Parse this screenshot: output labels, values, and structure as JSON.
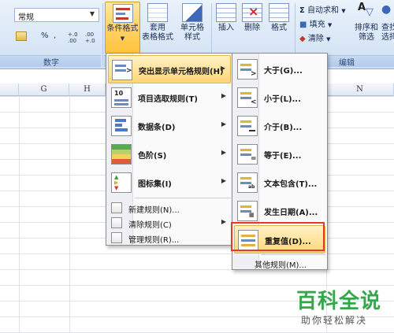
{
  "ribbon": {
    "number_group": {
      "format_value": "常规",
      "percent_label": "%",
      "comma_label": ",",
      "increase_decimal_label": "+.0 .00",
      "decrease_decimal_label": ".00 +.0",
      "label": "数字"
    },
    "styles_group": {
      "conditional_format_label": "条件格式",
      "table_format_label_1": "套用",
      "table_format_label_2": "表格格式",
      "cell_styles_label_1": "单元格",
      "cell_styles_label_2": "样式"
    },
    "cells_group": {
      "insert_label": "插入",
      "delete_label": "删除",
      "format_label": "格式"
    },
    "editing_group": {
      "autosum_label": "自动求和",
      "fill_label": "填充",
      "clear_label": "清除",
      "sort_filter_label_1": "排序和",
      "sort_filter_label_2": "筛选",
      "find_select_label_1": "查找",
      "find_select_label_2": "选择",
      "label": "编辑"
    }
  },
  "sheet": {
    "columns": [
      "G",
      "H",
      "N"
    ]
  },
  "cond_menu": {
    "items": [
      {
        "label": "突出显示单元格规则(H)"
      },
      {
        "label": "项目选取规则(T)"
      },
      {
        "label": "数据条(D)"
      },
      {
        "label": "色阶(S)"
      },
      {
        "label": "图标集(I)"
      }
    ],
    "small_items": [
      {
        "label": "新建规则(N)..."
      },
      {
        "label": "清除规则(C)"
      },
      {
        "label": "管理规则(R)..."
      }
    ]
  },
  "sub_menu": {
    "items": [
      {
        "label": "大于(G)..."
      },
      {
        "label": "小于(L)..."
      },
      {
        "label": "介于(B)..."
      },
      {
        "label": "等于(E)..."
      },
      {
        "label": "文本包含(T)..."
      },
      {
        "label": "发生日期(A)..."
      },
      {
        "label": "重复值(D)..."
      }
    ],
    "more_rules": "其他规则(M)..."
  },
  "watermark": {
    "big": "百科全说",
    "small": "助你轻松解决"
  },
  "colors": {
    "highlight": "#ffd777",
    "red_box": "#e23b2b",
    "watermark_green": "#35a64a"
  }
}
